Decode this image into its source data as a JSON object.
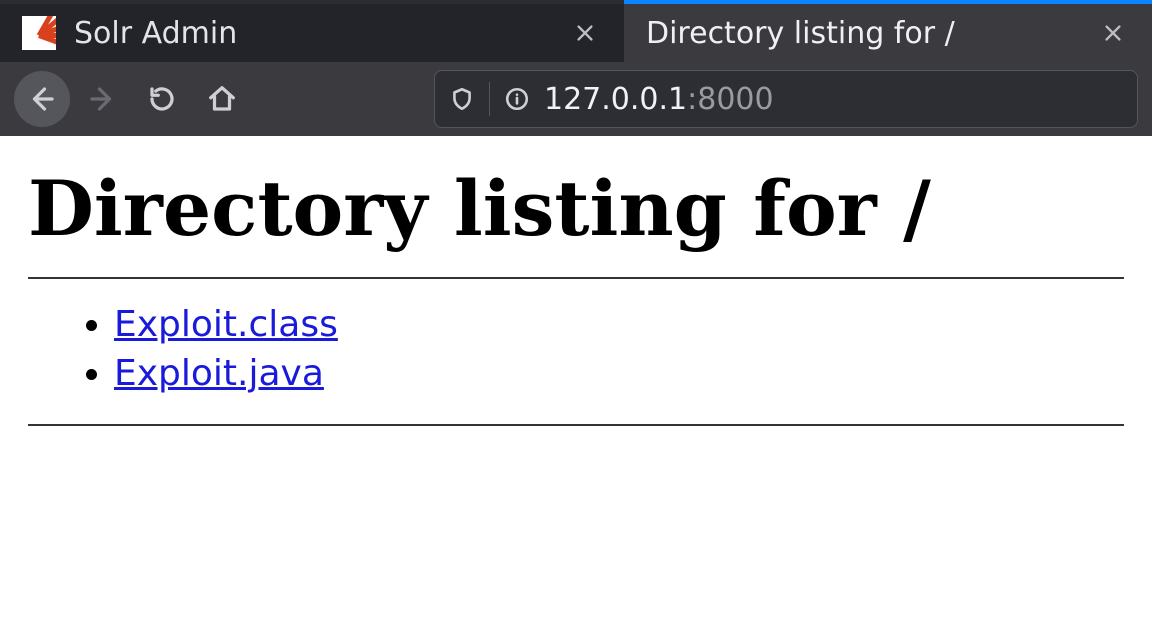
{
  "tabs": [
    {
      "title": "Solr Admin",
      "active": false,
      "favicon": "solr"
    },
    {
      "title": "Directory listing for /",
      "active": true,
      "favicon": "none"
    }
  ],
  "url": {
    "host": "127.0.0.1",
    "port": ":8000"
  },
  "page": {
    "heading": "Directory listing for /",
    "files": [
      {
        "name": "Exploit.class"
      },
      {
        "name": "Exploit.java"
      }
    ]
  }
}
